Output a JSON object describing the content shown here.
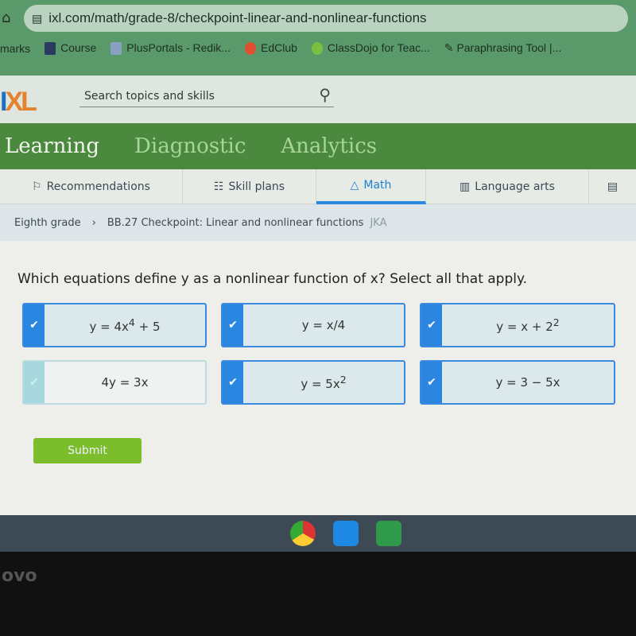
{
  "browser": {
    "url": "ixl.com/math/grade-8/checkpoint-linear-and-nonlinear-functions",
    "bookmarks": [
      "marks",
      "Course",
      "PlusPortals - Redik...",
      "EdClub",
      "ClassDojo for Teac...",
      "Paraphrasing Tool |..."
    ]
  },
  "header": {
    "logo": "IXL",
    "search_placeholder": "Search topics and skills"
  },
  "nav": [
    "Learning",
    "Diagnostic",
    "Analytics"
  ],
  "subnav": [
    "Recommendations",
    "Skill plans",
    "Math",
    "Language arts"
  ],
  "breadcrumb": {
    "grade": "Eighth grade",
    "skill": "BB.27 Checkpoint: Linear and nonlinear functions",
    "code": "JKA"
  },
  "question": "Which equations define y as a nonlinear function of x? Select all that apply.",
  "options": [
    {
      "label": "y = 4x⁴ + 5",
      "selected": true
    },
    {
      "label": "y = x/4",
      "selected": true
    },
    {
      "label": "y = x + 2²",
      "selected": true
    },
    {
      "label": "4y = 3x",
      "selected": false
    },
    {
      "label": "y = 5x²",
      "selected": true
    },
    {
      "label": "y = 3 − 5x",
      "selected": true
    }
  ],
  "submit": "Submit",
  "device_brand": "ovo",
  "colors": {
    "accent": "#2a86e0",
    "nav_green": "#4b8a3e",
    "submit_green": "#7bbd2a"
  }
}
